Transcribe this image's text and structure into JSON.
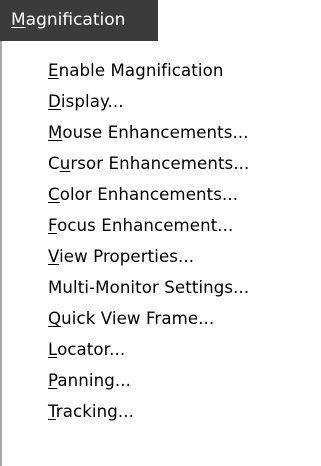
{
  "menu": {
    "title": {
      "pre": "",
      "acc": "M",
      "post": "agnification"
    },
    "items": [
      {
        "pre": "",
        "acc": "E",
        "post": "nable Magnification"
      },
      {
        "pre": "",
        "acc": "D",
        "post": "isplay..."
      },
      {
        "pre": "",
        "acc": "M",
        "post": "ouse Enhancements..."
      },
      {
        "pre": "C",
        "acc": "u",
        "post": "rsor Enhancements..."
      },
      {
        "pre": "",
        "acc": "C",
        "post": "olor Enhancements..."
      },
      {
        "pre": "",
        "acc": "F",
        "post": "ocus Enhancement..."
      },
      {
        "pre": "",
        "acc": "V",
        "post": "iew Properties..."
      },
      {
        "pre": "Multi-Monitor Settings...",
        "acc": "",
        "post": ""
      },
      {
        "pre": "",
        "acc": "Q",
        "post": "uick View Frame..."
      },
      {
        "pre": "",
        "acc": "L",
        "post": "ocator..."
      },
      {
        "pre": "",
        "acc": "P",
        "post": "anning..."
      },
      {
        "pre": "",
        "acc": "T",
        "post": "racking..."
      }
    ]
  }
}
